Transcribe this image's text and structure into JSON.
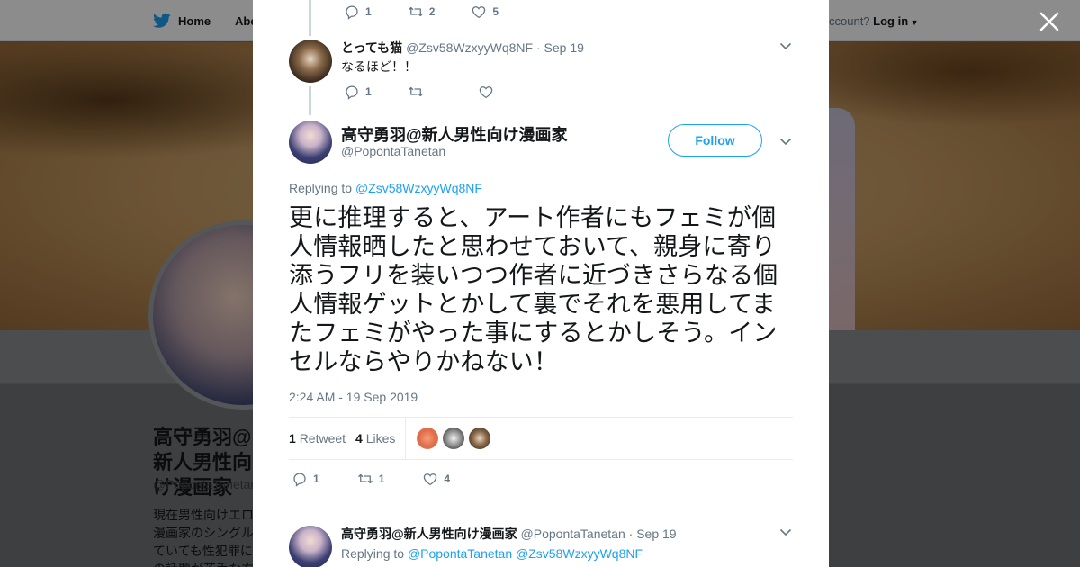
{
  "background": {
    "nav": {
      "home_label": "Home",
      "about_label": "Abo"
    },
    "login": {
      "account_text": "ccount?",
      "login_label": "Log in"
    },
    "profile": {
      "name": "高守勇羽@新人男性向け漫画家",
      "handle": "@PopontaTanetan",
      "bio_lines": [
        "現在男性向けエロ漫画",
        "漫画家のシングルマザー",
        "ていても性犯罪にあう",
        "の話題が苦手な方"
      ]
    }
  },
  "thread": {
    "prev_actions": {
      "reply": "1",
      "retweet": "2",
      "like": "5"
    },
    "reply_tweet": {
      "name": "とっても猫",
      "handle": "@Zsv58WzxyyWq8NF",
      "date": "· Sep 19",
      "text": "なるほど！！",
      "actions": {
        "reply": "1"
      }
    },
    "main_tweet": {
      "name": "高守勇羽@新人男性向け漫画家",
      "handle": "@PopontaTanetan",
      "follow_label": "Follow",
      "replying_prefix": "Replying to",
      "replying_to": "@Zsv58WzxyyWq8NF",
      "text": "更に推理すると、アート作者にもフェミが個人情報晒したと思わせておいて、親身に寄り添うフリを装いつつ作者に近づきさらなる個人情報ゲットとかして裏でそれを悪用してまたフェミがやった事にするとかしそう。インセルならやりかねない！",
      "timestamp": "2:24 AM - 19 Sep 2019",
      "retweets_count": "1",
      "retweets_label": "Retweet",
      "likes_count": "4",
      "likes_label": "Likes",
      "actions": {
        "reply": "1",
        "retweet": "1",
        "like": "4"
      }
    },
    "next_tweet": {
      "name": "高守勇羽@新人男性向け漫画家",
      "handle": "@PopontaTanetan",
      "date": "· Sep 19",
      "replying_prefix": "Replying to",
      "replying_to_1": "@PopontaTanetan",
      "replying_to_2": "@Zsv58WzxyyWq8NF"
    }
  },
  "colors": {
    "accent": "#1da1f2",
    "muted": "#657786",
    "text": "#14171a"
  }
}
